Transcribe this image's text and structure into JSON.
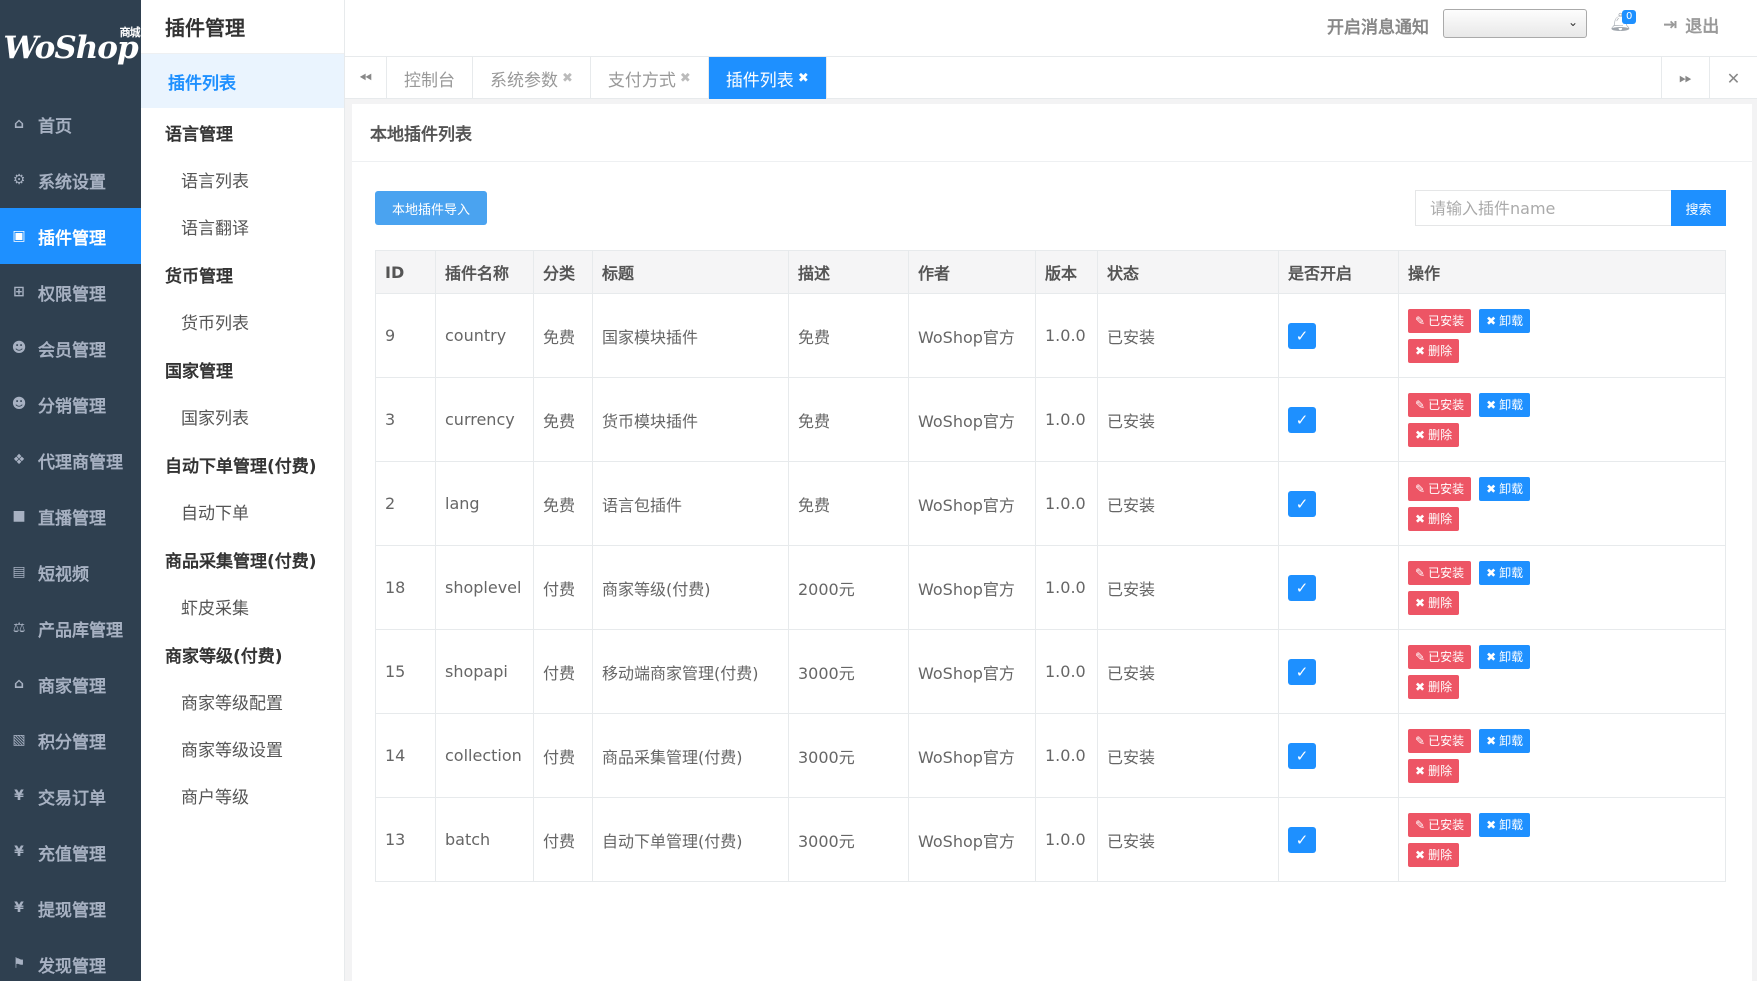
{
  "brand": {
    "logo": "WoShop",
    "logo_sup": "商城"
  },
  "main_nav": [
    {
      "label": "首页",
      "icon": "home-icon",
      "glyph": "⌂"
    },
    {
      "label": "系统设置",
      "icon": "gear-icon",
      "glyph": "⚙"
    },
    {
      "label": "插件管理",
      "icon": "plugin-icon",
      "glyph": "▣",
      "active": true
    },
    {
      "label": "权限管理",
      "icon": "sitemap-icon",
      "glyph": "⊞"
    },
    {
      "label": "会员管理",
      "icon": "users-icon",
      "glyph": "☻"
    },
    {
      "label": "分销管理",
      "icon": "users-icon",
      "glyph": "☻"
    },
    {
      "label": "代理商管理",
      "icon": "cubes-icon",
      "glyph": "❖"
    },
    {
      "label": "直播管理",
      "icon": "video-icon",
      "glyph": "■"
    },
    {
      "label": "短视频",
      "icon": "file-icon",
      "glyph": "▤"
    },
    {
      "label": "产品库管理",
      "icon": "balance-icon",
      "glyph": "⚖"
    },
    {
      "label": "商家管理",
      "icon": "bank-icon",
      "glyph": "⌂"
    },
    {
      "label": "积分管理",
      "icon": "document-icon",
      "glyph": "▧"
    },
    {
      "label": "交易订单",
      "icon": "currency-icon",
      "glyph": "¥"
    },
    {
      "label": "充值管理",
      "icon": "yen-icon",
      "glyph": "¥"
    },
    {
      "label": "提现管理",
      "icon": "yen-icon",
      "glyph": "¥"
    },
    {
      "label": "发现管理",
      "icon": "flag-icon",
      "glyph": "⚑"
    }
  ],
  "sub_nav": {
    "title": "插件管理",
    "active_item": "插件列表",
    "groups": [
      {
        "label": "语言管理",
        "items": [
          "语言列表",
          "语言翻译"
        ]
      },
      {
        "label": "货币管理",
        "items": [
          "货币列表"
        ]
      },
      {
        "label": "国家管理",
        "items": [
          "国家列表"
        ]
      },
      {
        "label": "自动下单管理(付费)",
        "items": [
          "自动下单"
        ]
      },
      {
        "label": "商品采集管理(付费)",
        "items": [
          "虾皮采集"
        ]
      },
      {
        "label": "商家等级(付费)",
        "items": [
          "商家等级配置",
          "商家等级设置",
          "商户等级"
        ]
      }
    ]
  },
  "header": {
    "notify_label": "开启消息通知",
    "notify_select_value": "",
    "bell_count": "0",
    "logout_label": "退出"
  },
  "tabs": [
    {
      "label": "控制台",
      "closable": false
    },
    {
      "label": "系统参数",
      "closable": true
    },
    {
      "label": "支付方式",
      "closable": true
    },
    {
      "label": "插件列表",
      "closable": true,
      "active": true
    }
  ],
  "content": {
    "title": "本地插件列表",
    "import_button": "本地插件导入",
    "search_placeholder": "请输入插件name",
    "search_button": "搜索",
    "columns": [
      "ID",
      "插件名称",
      "分类",
      "标题",
      "描述",
      "作者",
      "版本",
      "状态",
      "是否开启",
      "操作"
    ],
    "rows": [
      {
        "id": "9",
        "name": "country",
        "category": "免费",
        "title": "国家模块插件",
        "desc": "免费",
        "author": "WoShop官方",
        "version": "1.0.0",
        "status": "已安装",
        "enabled": true
      },
      {
        "id": "3",
        "name": "currency",
        "category": "免费",
        "title": "货币模块插件",
        "desc": "免费",
        "author": "WoShop官方",
        "version": "1.0.0",
        "status": "已安装",
        "enabled": true
      },
      {
        "id": "2",
        "name": "lang",
        "category": "免费",
        "title": "语言包插件",
        "desc": "免费",
        "author": "WoShop官方",
        "version": "1.0.0",
        "status": "已安装",
        "enabled": true
      },
      {
        "id": "18",
        "name": "shoplevel",
        "category": "付费",
        "title": "商家等级(付费)",
        "desc": "2000元",
        "author": "WoShop官方",
        "version": "1.0.0",
        "status": "已安装",
        "enabled": true
      },
      {
        "id": "15",
        "name": "shopapi",
        "category": "付费",
        "title": "移动端商家管理(付费)",
        "desc": "3000元",
        "author": "WoShop官方",
        "version": "1.0.0",
        "status": "已安装",
        "enabled": true
      },
      {
        "id": "14",
        "name": "collection",
        "category": "付费",
        "title": "商品采集管理(付费)",
        "desc": "3000元",
        "author": "WoShop官方",
        "version": "1.0.0",
        "status": "已安装",
        "enabled": true
      },
      {
        "id": "13",
        "name": "batch",
        "category": "付费",
        "title": "自动下单管理(付费)",
        "desc": "3000元",
        "author": "WoShop官方",
        "version": "1.0.0",
        "status": "已安装",
        "enabled": true
      }
    ],
    "actions": {
      "installed": "已安装",
      "uninstall": "卸载",
      "delete": "删除"
    }
  },
  "colors": {
    "sidebar_bg": "#2f4050",
    "accent": "#1e90ff",
    "danger": "#ed5565"
  }
}
